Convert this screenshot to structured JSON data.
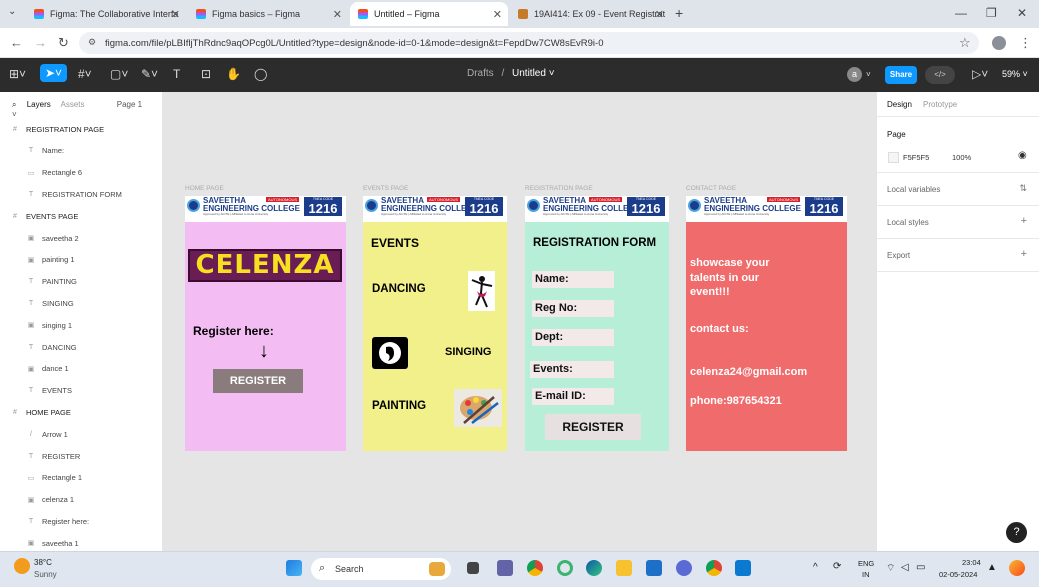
{
  "browser": {
    "tabs": [
      {
        "title": "Figma: The Collaborative Interfa",
        "active": false
      },
      {
        "title": "Figma basics – Figma",
        "active": false
      },
      {
        "title": "Untitled – Figma",
        "active": true
      },
      {
        "title": "19AI414: Ex 09 - Event Registrat",
        "active": false
      }
    ],
    "new_tab": "+",
    "url": "figma.com/file/pLBIfljThRdnc9aqOPcg0L/Untitled?type=design&node-id=0-1&mode=design&t=FepdDw7CW8sEvR9i-0"
  },
  "figma_toolbar": {
    "drafts": "Drafts",
    "separator": "/",
    "file_name": "Untitled",
    "avatar_letter": "a",
    "share_label": "Share",
    "zoom": "59%"
  },
  "left_panel": {
    "tabs": [
      "Layers",
      "Assets"
    ],
    "page_selector": "Page 1",
    "layers": [
      {
        "name": "REGISTRATION PAGE",
        "icon": "#",
        "indent": 0
      },
      {
        "name": "Name:",
        "icon": "T",
        "indent": 1
      },
      {
        "name": "Rectangle 6",
        "icon": "▭",
        "indent": 1
      },
      {
        "name": "REGISTRATION FORM",
        "icon": "T",
        "indent": 1
      },
      {
        "name": "EVENTS PAGE",
        "icon": "#",
        "indent": 0
      },
      {
        "name": "saveetha 2",
        "icon": "▣",
        "indent": 1
      },
      {
        "name": "painting 1",
        "icon": "▣",
        "indent": 1
      },
      {
        "name": "PAINTING",
        "icon": "T",
        "indent": 1
      },
      {
        "name": "SINGING",
        "icon": "T",
        "indent": 1
      },
      {
        "name": "singing 1",
        "icon": "▣",
        "indent": 1
      },
      {
        "name": "DANCING",
        "icon": "T",
        "indent": 1
      },
      {
        "name": "dance 1",
        "icon": "▣",
        "indent": 1
      },
      {
        "name": "EVENTS",
        "icon": "T",
        "indent": 1
      },
      {
        "name": "HOME PAGE",
        "icon": "#",
        "indent": 0
      },
      {
        "name": "Arrow 1",
        "icon": "/",
        "indent": 1
      },
      {
        "name": "REGISTER",
        "icon": "T",
        "indent": 1
      },
      {
        "name": "Rectangle 1",
        "icon": "▭",
        "indent": 1
      },
      {
        "name": "celenza 1",
        "icon": "▣",
        "indent": 1
      },
      {
        "name": "Register here:",
        "icon": "T",
        "indent": 1
      },
      {
        "name": "saveetha 1",
        "icon": "▣",
        "indent": 1
      }
    ]
  },
  "canvas": {
    "logo": {
      "name_line1": "SAVEETHA",
      "name_line2": "ENGINEERING COLLEGE",
      "autonomous": "AUTONOMOUS",
      "code_label": "TNEA CODE",
      "code": "1216",
      "sub": "Approved by AICTE | Affiliated to Anna University"
    },
    "frames": [
      {
        "label": "HOME PAGE",
        "bg": "#f3bdf3"
      },
      {
        "label": "EVENTS PAGE",
        "bg": "#f2f08a"
      },
      {
        "label": "REGISTRATION PAGE",
        "bg": "#b6eed8"
      },
      {
        "label": "CONTACT PAGE",
        "bg": "#f06b6b"
      }
    ],
    "home": {
      "celenza": "CELENZA",
      "register_here": "Register here:",
      "arrow": "↓",
      "register_btn": "REGISTER"
    },
    "events": {
      "title": "EVENTS",
      "dancing": "DANCING",
      "singing": "SINGING",
      "painting": "PAINTING"
    },
    "registration": {
      "title": "REGISTRATION FORM",
      "fields": [
        "Name:",
        "Reg No:",
        "Dept:",
        "Events:",
        "E-mail ID:"
      ],
      "register_btn": "REGISTER"
    },
    "contact": {
      "showcase": "showcase your talents in our event!!!",
      "contact_us": "contact us:",
      "email": "celenza24@gmail.com",
      "phone": "phone:987654321"
    }
  },
  "right_panel": {
    "tabs": [
      "Design",
      "Prototype"
    ],
    "page_heading": "Page",
    "page_color": "F5F5F5",
    "page_opacity": "100%",
    "local_variables": "Local variables",
    "local_styles": "Local styles",
    "export": "Export",
    "help": "?"
  },
  "taskbar": {
    "temp": "38°C",
    "weather": "Sunny",
    "search_placeholder": "Search",
    "lang1": "ENG",
    "lang2": "IN",
    "time": "23:04",
    "date": "02-05-2024"
  }
}
